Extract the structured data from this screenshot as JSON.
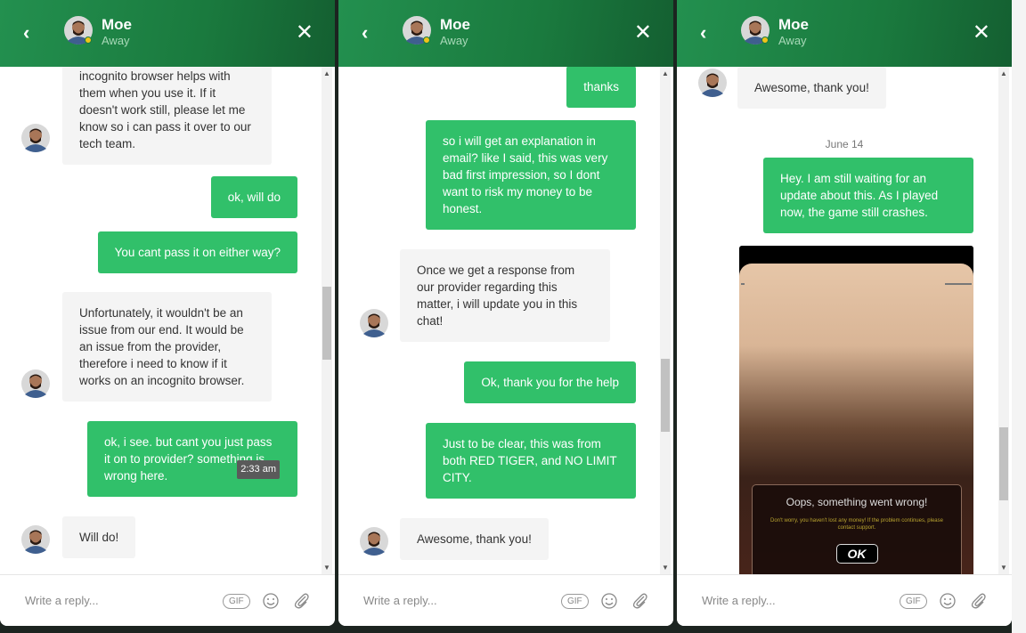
{
  "agent": {
    "name": "Moe",
    "status": "Away"
  },
  "colors": {
    "header": "#1a7a3e",
    "user_bubble": "#31c06a",
    "agent_bubble": "#f4f4f4",
    "status_dot": "#f0c419"
  },
  "footer": {
    "placeholder": "Write a reply...",
    "gif_label": "GIF"
  },
  "panels": [
    {
      "messages": [
        {
          "from": "agent",
          "text": "incognito browser helps with them when you use it. If it doesn't work still, please let me know so i can pass it over to our tech team."
        },
        {
          "from": "user",
          "text": "ok, will do"
        },
        {
          "from": "user",
          "text": "You cant pass it on either way?"
        },
        {
          "from": "agent",
          "text": "Unfortunately, it wouldn't be an issue from our end. It would be an issue from the provider, therefore i need to know if it works on an incognito browser."
        },
        {
          "from": "user",
          "text": "ok, i see. but cant you just pass it on to provider? something is wrong here.",
          "time": "2:33 am"
        },
        {
          "from": "agent",
          "text": "Will do!"
        }
      ]
    },
    {
      "messages": [
        {
          "from": "user",
          "text": "thanks"
        },
        {
          "from": "user",
          "text": "so i will get an explanation in email? like I said, this was very bad first impression, so I dont want to risk my money to be honest."
        },
        {
          "from": "agent",
          "text": "Once we get a response from our provider regarding this matter, i will update you in this chat!"
        },
        {
          "from": "user",
          "text": "Ok, thank you for the help"
        },
        {
          "from": "user",
          "text": "Just to be clear, this was from both RED TIGER, and NO LIMIT CITY."
        },
        {
          "from": "agent",
          "text": "Awesome, thank you!"
        }
      ]
    },
    {
      "messages": [
        {
          "from": "agent",
          "text": "Awesome, thank you!"
        },
        {
          "from": "date",
          "text": "June 14"
        },
        {
          "from": "user",
          "text": "Hey. I am still waiting for an update about this. As I played now, the game still crashes."
        },
        {
          "from": "image",
          "error_title": "Oops, something went wrong!",
          "error_text": "Don't worry, you haven't lost any money! If the problem continues, please contact support.",
          "button": "OK"
        }
      ]
    }
  ],
  "scroll_positions": [
    0.5,
    0.6,
    0.85
  ]
}
